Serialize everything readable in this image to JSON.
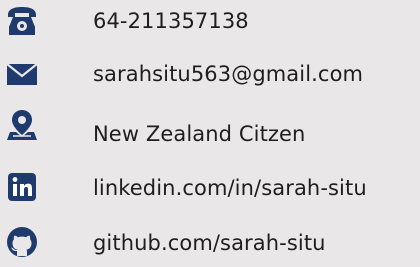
{
  "contact": {
    "phone": {
      "icon": "telephone-icon",
      "value": "64-211357138"
    },
    "email": {
      "icon": "envelope-icon",
      "value": "sarahsitu563@gmail.com"
    },
    "residency": {
      "icon": "location-pin-icon",
      "value": "New Zealand Citzen"
    },
    "linkedin": {
      "icon": "linkedin-icon",
      "value": "linkedin.com/in/sarah-situ"
    },
    "github": {
      "icon": "github-icon",
      "value": "github.com/sarah-situ"
    }
  },
  "colors": {
    "background": "#e9e7e8",
    "icon": "#1f3b6e",
    "text": "#1e1e1e"
  }
}
